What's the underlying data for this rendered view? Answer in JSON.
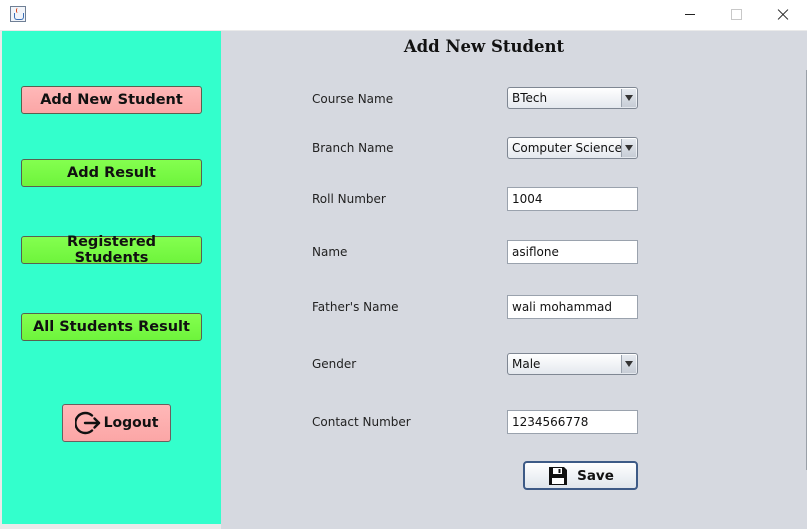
{
  "window": {
    "controls": {
      "minimize_icon": "minimize-icon",
      "maximize_icon": "maximize-icon",
      "close_icon": "close-icon"
    }
  },
  "sidebar": {
    "background": "#33ffcc",
    "buttons": [
      {
        "label": "Add New Student",
        "color": "#ffb3b3"
      },
      {
        "label": "Add Result",
        "color": "#7cff47"
      },
      {
        "label": "Registered Students",
        "color": "#7cff47"
      },
      {
        "label": "All Students Result",
        "color": "#7cff47"
      }
    ],
    "logout": {
      "label": "Logout",
      "icon": "logout-icon",
      "color": "#ffb3b3"
    }
  },
  "form": {
    "title": "Add New Student",
    "background": "#d6d9e0",
    "fields": {
      "course": {
        "label": "Course Name",
        "value": "BTech"
      },
      "branch": {
        "label": "Branch Name",
        "value": "Computer Science"
      },
      "roll": {
        "label": "Roll Number",
        "value": "1004"
      },
      "name": {
        "label": "Name",
        "value": "asiflone"
      },
      "father": {
        "label": "Father's Name",
        "value": "wali mohammad"
      },
      "gender": {
        "label": "Gender",
        "value": "Male"
      },
      "contact": {
        "label": "Contact Number",
        "value": "1234566778"
      }
    },
    "save_label": "Save",
    "save_icon": "floppy-disk-icon"
  }
}
